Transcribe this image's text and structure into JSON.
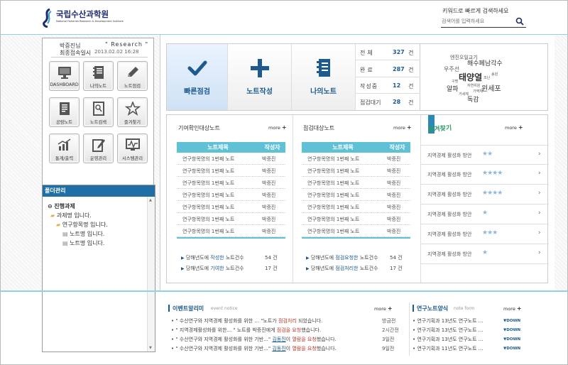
{
  "header": {
    "logo_title": "국립수산과학원",
    "logo_subtitle": "National Fisheries Research & Development Institute",
    "keyword_label": "키워드로 빠르게 검색하세요",
    "search_placeholder": "검색어를 입력하세요"
  },
  "user": {
    "name": "박증진님",
    "role": "\" Research \"",
    "last_login_label": "최종접속일시",
    "last_login": "2013.02.02 16:28"
  },
  "menu": [
    {
      "label": "DASHBOARD",
      "icon": "monitor-icon"
    },
    {
      "label": "나의노트",
      "icon": "notebook-icon"
    },
    {
      "label": "노트점검",
      "icon": "pencil-icon"
    },
    {
      "label": "공람노트",
      "icon": "document-icon"
    },
    {
      "label": "노트검색",
      "icon": "search-doc-icon"
    },
    {
      "label": "즐겨찾기",
      "icon": "star-icon"
    },
    {
      "label": "통계/출력",
      "icon": "bar-chart-icon"
    },
    {
      "label": "운영관리",
      "icon": "edit-doc-icon"
    },
    {
      "label": "시스템관리",
      "icon": "system-monitor-icon"
    }
  ],
  "folder": {
    "title": "폴더관리",
    "items": [
      "진행과제",
      "과제명 입니다.",
      "연구항목명 입니다.",
      "노트명 입니다.",
      "노트명 입니다."
    ]
  },
  "quick": {
    "buttons": [
      "빠른점검",
      "노트작성",
      "나의노트"
    ],
    "stats": [
      {
        "label": "전체",
        "value": "327",
        "unit": "건"
      },
      {
        "label": "완료",
        "value": "287",
        "unit": "건"
      },
      {
        "label": "작성중",
        "value": "12",
        "unit": "건"
      },
      {
        "label": "점검대기",
        "value": "28",
        "unit": "건"
      }
    ]
  },
  "cloud": {
    "words": [
      "엔진오일교기",
      "해수폐남각수",
      "우주선",
      "태양열",
      "윈세포",
      "조난",
      "구명",
      "송원",
      "알파",
      "거세체",
      "자연위원",
      "가역체",
      "독감"
    ]
  },
  "contrib": {
    "title": "기여확인대상노트",
    "more": "more",
    "col1": "노트제목",
    "col2": "작성자",
    "rows": [
      [
        "연구항목명의 1번째 노트",
        "박증진"
      ],
      [
        "연구항목명의 1번째 노트",
        "박증진"
      ],
      [
        "연구항목명의 1번째 노트",
        "박증진"
      ],
      [
        "연구항목명의 1번째 노트",
        "박증진"
      ],
      [
        "연구항목명의 1번째 노트",
        "박증진"
      ],
      [
        "연구항목명의 1번째 노트",
        "박증진"
      ],
      [
        "연구항목명의 1번째 노트",
        "박증진"
      ]
    ],
    "sum1_pre": "당해년도에 ",
    "sum1_hl": "작성한",
    "sum1_post": " 노트건수",
    "sum1_count": "54 건",
    "sum2_pre": "당해년도에 ",
    "sum2_hl": "기여한",
    "sum2_post": " 노트건수",
    "sum2_count": "17 건"
  },
  "check": {
    "title": "점검대상노트",
    "more": "more",
    "col1": "노트제목",
    "col2": "작성자",
    "rows": [
      [
        "연구항목명의 1번째 노트",
        "박증진"
      ],
      [
        "연구항목명의 1번째 노트",
        "박증진"
      ],
      [
        "연구항목명의 1번째 노트",
        "박증진"
      ],
      [
        "연구항목명의 1번째 노트",
        "박증진"
      ],
      [
        "연구항목명의 1번째 노트",
        "박증진"
      ],
      [
        "연구항목명의 1번째 노트",
        "박증진"
      ],
      [
        "연구항목명의 1번째 노트",
        "박증진"
      ]
    ],
    "sum1_pre": "당해년도에 ",
    "sum1_hl": "점검요청한",
    "sum1_post": " 노트건수",
    "sum1_count": "54 건",
    "sum2_pre": "당해년도에 ",
    "sum2_hl": "점검처리한",
    "sum2_post": " 노트건수",
    "sum2_count": "17 건"
  },
  "favorites": {
    "title": "즐겨찾기",
    "more": "more",
    "items": [
      {
        "title": "지역경제 활성화 방안",
        "stars": 2
      },
      {
        "title": "지역경제 활성화 방안",
        "stars": 4
      },
      {
        "title": "지역경제 활성화 방안",
        "stars": 4
      },
      {
        "title": "지역경제 활성화 방안",
        "stars": 1
      },
      {
        "title": "지역경제 활성화 방안",
        "stars": 3
      },
      {
        "title": "지역경제 활성화 방안",
        "stars": 1
      }
    ]
  },
  "events": {
    "title": "이벤트알리미",
    "subtitle": "event notice",
    "more": "more",
    "rows": [
      {
        "a": "\" 수산연구와 지역경제 활성화를 위한 ... \"노트가 ",
        "b": "점검처리",
        "c": " 되었습니다.",
        "date": "방금전"
      },
      {
        "a": "\" 지역경제활성화를 위한... \" 노트를 박증진에게 ",
        "b": "점검을 요청",
        "c": "했습니다.",
        "date": "2시간전"
      },
      {
        "a": "\" 수산연구와 지역경제 활성화를 위한 기반...\" ",
        "u": "김동진",
        "a2": "이 ",
        "b": "열람을 요청",
        "c": "했습니다.",
        "date": "3일전"
      },
      {
        "a": "\" 수산연구와 지역경제 활성화를 위한 기반...\" ",
        "u": "김동진",
        "a2": "이 ",
        "b": "열람을 요청",
        "c": "했습니다.",
        "date": "9일전"
      }
    ]
  },
  "forms": {
    "title": "연구노트양식",
    "subtitle": "note form",
    "more": "more",
    "rows": [
      "연구기획과 13년도 연구노트 ...",
      "연구기획과 13년도 연구노트 ...",
      "연구기획과 13년도 연구노트 ...",
      "연구기획과 11년도 연구노트 ..."
    ],
    "down": "DOWN"
  },
  "colors": {
    "accent": "#5fc0d6",
    "brand": "#1d5a8f",
    "folder_header": "#1d6fa5",
    "star": "#8fb7e0",
    "highlight": "#c0392b"
  }
}
